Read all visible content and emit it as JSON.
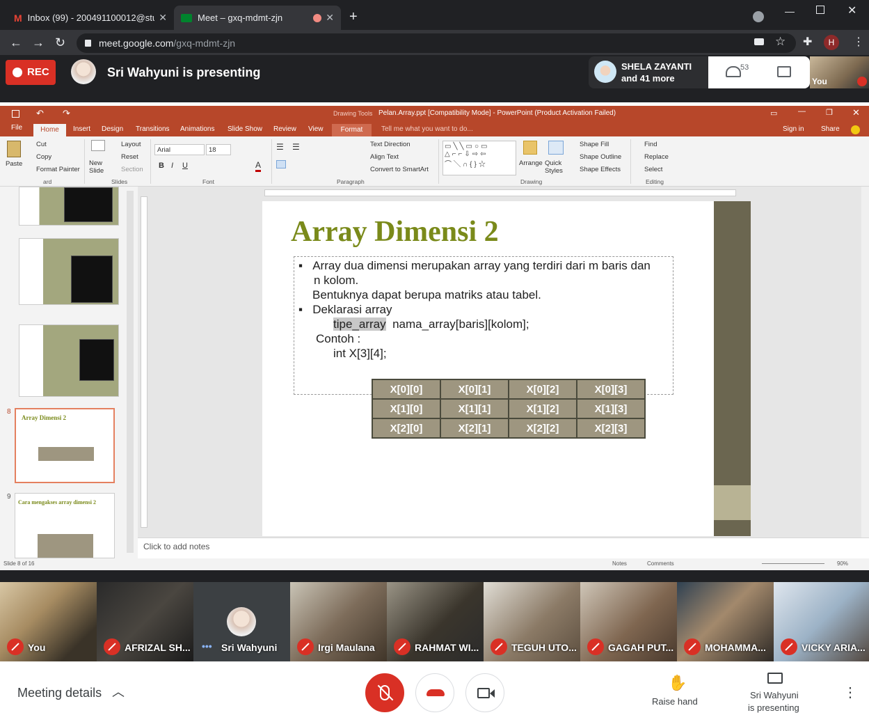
{
  "browser": {
    "tabs": [
      {
        "label": "Inbox (99) - 200491100012@stud"
      },
      {
        "label": "Meet – gxq-mdmt-zjn"
      }
    ],
    "url_host": "meet.google.com",
    "url_path": "/gxq-mdmt-zjn",
    "profile_initial": "H"
  },
  "meet_top": {
    "rec_label": "REC",
    "presenting_text": "Sri Wahyuni is presenting",
    "participants_name": "SHELA ZAYANTI",
    "participants_more": "and 41 more",
    "people_count": "53",
    "self_label": "You"
  },
  "ppt": {
    "context_tab": "Drawing Tools",
    "title": "Pelan.Array.ppt [Compatibility Mode] - PowerPoint (Product Activation Failed)",
    "tabs": [
      "File",
      "Home",
      "Insert",
      "Design",
      "Transitions",
      "Animations",
      "Slide Show",
      "Review",
      "View",
      "Format"
    ],
    "tell_me": "Tell me what you want to do...",
    "sign_in": "Sign in",
    "share": "Share",
    "clipboard": {
      "paste": "Paste",
      "cut": "Cut",
      "copy": "Copy",
      "format_painter": "Format Painter",
      "group": "ard"
    },
    "slides_group": {
      "new_slide": "New Slide",
      "layout": "Layout",
      "reset": "Reset",
      "section": "Section",
      "group": "Slides"
    },
    "font_group": {
      "font": "Arial",
      "size": "18",
      "group": "Font"
    },
    "paragraph_group": {
      "text_direction": "Text Direction",
      "align_text": "Align Text",
      "convert": "Convert to SmartArt",
      "group": "Paragraph"
    },
    "drawing_group": {
      "arrange": "Arrange",
      "quick_styles": "Quick Styles",
      "shape_fill": "Shape Fill",
      "shape_outline": "Shape Outline",
      "shape_effects": "Shape Effects",
      "group": "Drawing"
    },
    "editing_group": {
      "find": "Find",
      "replace": "Replace",
      "select": "Select",
      "group": "Editing"
    },
    "thumb_numbers": [
      "8",
      "9"
    ],
    "thumb8_title": "Array Dimensi 2",
    "thumb9_title": "Cara mengakses array dimensi 2",
    "slide": {
      "title": "Array Dimensi 2",
      "line1": "Array dua dimensi merupakan array yang terdiri dari m baris dan",
      "line2": "n kolom.",
      "line3": "Bentuknya dapat berupa matriks atau tabel.",
      "line4": "Deklarasi array",
      "line5a": "tipe_array",
      "line5b": "nama_array[baris][kolom];",
      "line6": "Contoh :",
      "line7": "int X[3][4];",
      "table": [
        [
          "X[0][0]",
          "X[0][1]",
          "X[0][2]",
          "X[0][3]"
        ],
        [
          "X[1][0]",
          "X[1][1]",
          "X[1][2]",
          "X[1][3]"
        ],
        [
          "X[2][0]",
          "X[2][1]",
          "X[2][2]",
          "X[2][3]"
        ]
      ]
    },
    "notes_placeholder": "Click to add notes",
    "status_slide": "Slide 8 of 16",
    "notes_btn": "Notes",
    "comments_btn": "Comments",
    "zoom": "90%"
  },
  "participants": [
    {
      "name": "You"
    },
    {
      "name": "AFRIZAL SH..."
    },
    {
      "name": "Sri Wahyuni"
    },
    {
      "name": "Irgi Maulana"
    },
    {
      "name": "RAHMAT WI..."
    },
    {
      "name": "TEGUH UTO..."
    },
    {
      "name": "GAGAH PUT..."
    },
    {
      "name": "MOHAMMA..."
    },
    {
      "name": "VICKY ARIA..."
    }
  ],
  "bottom": {
    "meeting_details": "Meeting details",
    "raise_hand": "Raise hand",
    "presenting_line1": "Sri Wahyuni",
    "presenting_line2": "is presenting"
  },
  "colors": {
    "rec": "#d93025",
    "ppt_accent": "#b7472a",
    "slide_title": "#7a8a1a",
    "table_cell": "#9e9680"
  }
}
